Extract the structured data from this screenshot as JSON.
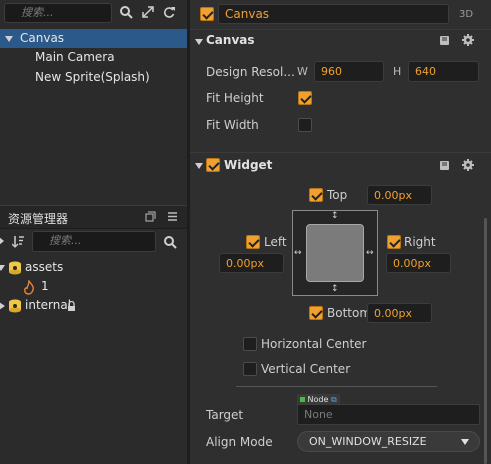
{
  "hierarchy": {
    "search_placeholder": "搜索...",
    "items": [
      {
        "label": "Canvas"
      },
      {
        "label": "Main Camera"
      },
      {
        "label": "New Sprite(Splash)"
      }
    ]
  },
  "assets": {
    "title": "资源管理器",
    "search_placeholder": "搜索...",
    "items": [
      {
        "label": "assets"
      },
      {
        "label": "1"
      },
      {
        "label": "internal"
      }
    ]
  },
  "inspector": {
    "node_name": "Canvas",
    "mode_3d": "3D",
    "canvas": {
      "title": "Canvas",
      "design_label": "Design Resol...",
      "w_label": "W",
      "h_label": "H",
      "width": "960",
      "height": "640",
      "fit_height_label": "Fit Height",
      "fit_height": true,
      "fit_width_label": "Fit Width",
      "fit_width": false
    },
    "widget": {
      "title": "Widget",
      "top_label": "Top",
      "top_value": "0.00px",
      "left_label": "Left",
      "left_value": "0.00px",
      "right_label": "Right",
      "right_value": "0.00px",
      "bottom_label": "Bottom",
      "bottom_value": "0.00px",
      "hcenter_label": "Horizontal Center",
      "vcenter_label": "Vertical Center",
      "node_tag": "Node",
      "target_label": "Target",
      "target_value": "None",
      "align_mode_label": "Align Mode",
      "align_mode_value": "ON_WINDOW_RESIZE"
    }
  },
  "colors": {
    "accent": "#f0a030",
    "selection": "#2b5a8a",
    "value_text": "#f0a030"
  }
}
